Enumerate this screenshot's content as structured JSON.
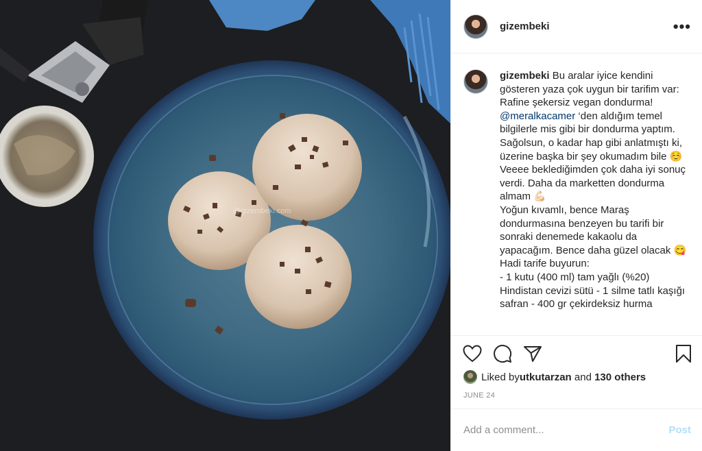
{
  "photo": {
    "alt_description": "",
    "watermark": "@gizembeki.com"
  },
  "header": {
    "username": "gizembeki",
    "more_icon": "more-horizontal-icon",
    "more_label": "•••"
  },
  "caption": {
    "username": "gizembeki",
    "text_part1": " Bu aralar iyice kendini gösteren yaza çok uygun bir tarifim var: Rafine şekersiz vegan dondurma! ",
    "mention": "@meralkacamer",
    "text_part2": " ‘den aldığım temel bilgilerle mis gibi bir dondurma yaptım. Sağolsun, o kadar hap gibi anlatmıştı ki, üzerine başka bir şey okumadım bile ☺️\nVeeee beklediğimden çok daha iyi sonuç verdi. Daha da marketten dondurma almam 💪🏻\nYoğun kıvamlı, bence Maraş dondurmasına benzeyen bu tarifi bir sonraki denemede kakaolu da yapacağım. Bence daha güzel olacak 😋\nHadi tarife buyurun:\n- 1 kutu (400 ml) tam yağlı (%20) Hindistan cevizi sütü - 1 silme tatlı kaşığı safran - 400 gr çekirdeksiz hurma"
  },
  "actions": {
    "like_icon": "heart-icon",
    "comment_icon": "comment-icon",
    "share_icon": "share-icon",
    "save_icon": "bookmark-icon"
  },
  "likes": {
    "prefix": "Liked by ",
    "user": "utkutarzan",
    "middle": " and ",
    "others": "130 others"
  },
  "date": "JUNE 24",
  "comment": {
    "placeholder": "Add a comment...",
    "post_label": "Post"
  },
  "colors": {
    "accent_link": "#00376b",
    "post_disabled": "#b2dffc",
    "muted": "#8e8e8e"
  }
}
